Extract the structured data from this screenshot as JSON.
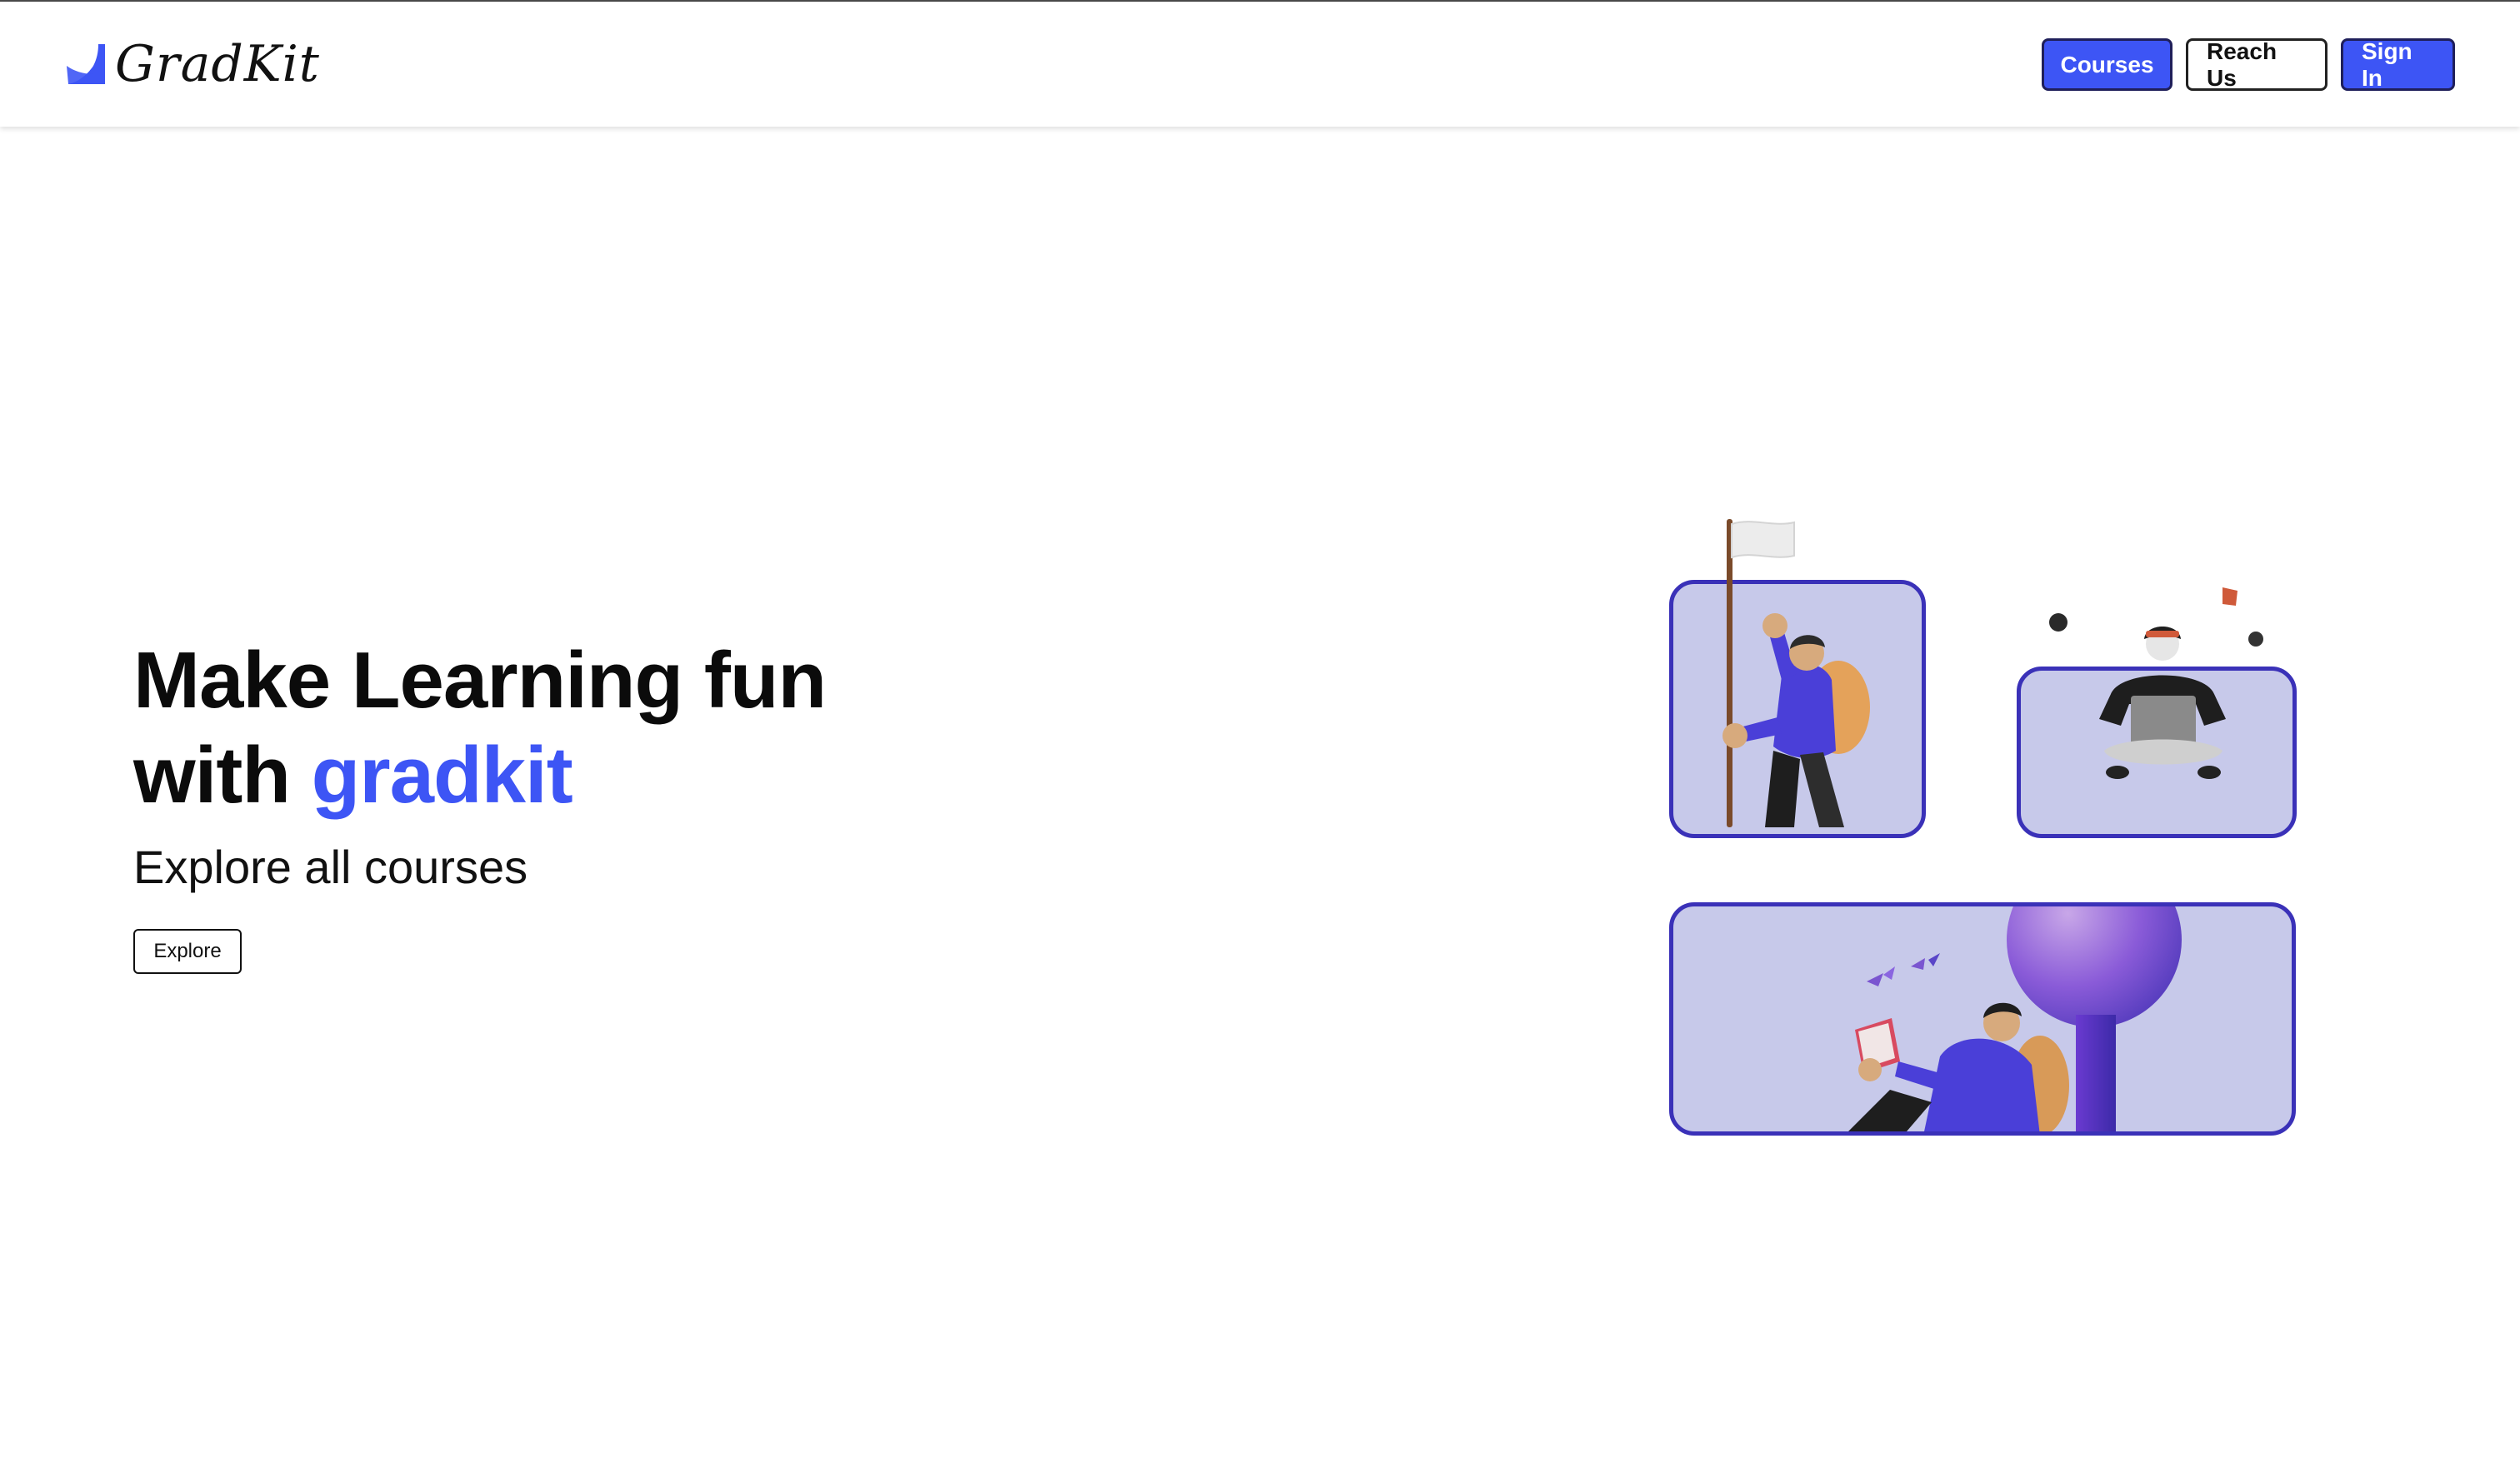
{
  "brand": {
    "name": "GradKit",
    "icon": "boat-sail-icon",
    "color": "#3d55f5"
  },
  "nav": {
    "courses_label": "Courses",
    "reach_label": "Reach Us",
    "signin_label": "Sign In"
  },
  "hero": {
    "title_line1": "Make Learning fun",
    "title_line2_prefix": "with ",
    "title_line2_accent": "gradkit",
    "subtitle": "Explore all courses",
    "explore_label": "Explore"
  },
  "colors": {
    "accent": "#3d55f5",
    "card_bg": "#c7c9ea",
    "card_border": "#3a31b8"
  },
  "illustrations": [
    {
      "name": "hiker-with-flag-illustration"
    },
    {
      "name": "person-with-laptop-illustration"
    },
    {
      "name": "person-reading-illustration"
    }
  ]
}
